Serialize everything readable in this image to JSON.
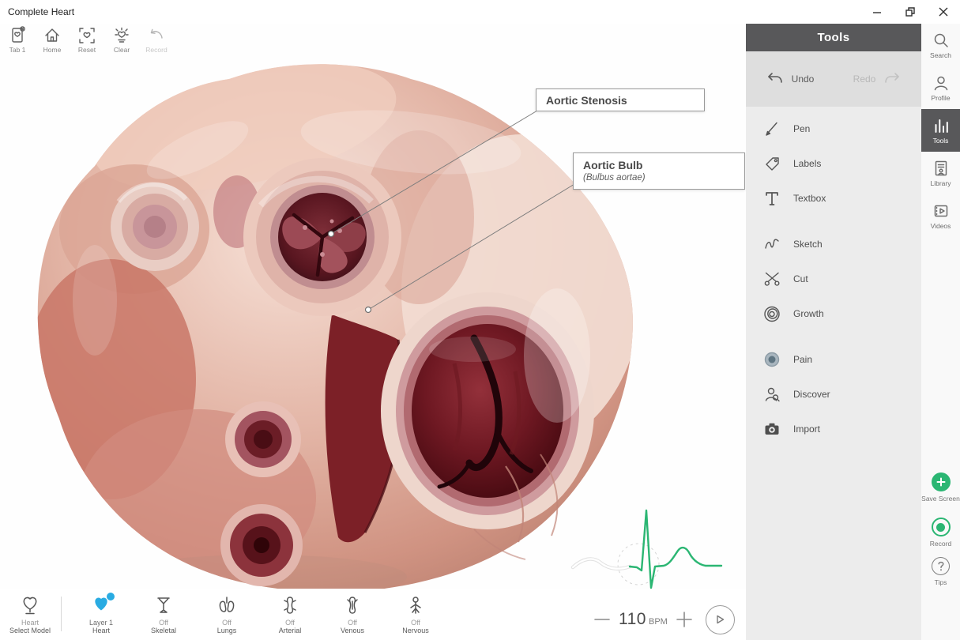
{
  "window": {
    "title": "Complete Heart"
  },
  "toolbar": {
    "items": [
      {
        "label": "Tab 1"
      },
      {
        "label": "Home"
      },
      {
        "label": "Reset"
      },
      {
        "label": "Clear"
      },
      {
        "label": "Record",
        "disabled": true
      }
    ]
  },
  "annotations": [
    {
      "label": "Aortic Stenosis"
    },
    {
      "label": "Aortic Bulb",
      "sublabel": "(Bulbus aortae)"
    }
  ],
  "tools_panel": {
    "title": "Tools",
    "undo_label": "Undo",
    "redo_label": "Redo",
    "tools": [
      {
        "label": "Pen"
      },
      {
        "label": "Labels"
      },
      {
        "label": "Textbox"
      },
      {
        "label": "Sketch"
      },
      {
        "label": "Cut"
      },
      {
        "label": "Growth"
      },
      {
        "label": "Pain"
      },
      {
        "label": "Discover"
      },
      {
        "label": "Import"
      }
    ]
  },
  "rail": {
    "items": [
      {
        "label": "Search"
      },
      {
        "label": "Profile"
      },
      {
        "label": "Tools",
        "active": true
      },
      {
        "label": "Library"
      },
      {
        "label": "Videos"
      }
    ],
    "bottom": [
      {
        "label": "Save Screen"
      },
      {
        "label": "Record"
      },
      {
        "label": "Tips"
      }
    ]
  },
  "bottom_bar": {
    "layers": [
      {
        "state": "Heart",
        "label": "Select Model"
      },
      {
        "state": "Layer 1",
        "label": "Heart",
        "active": true,
        "has_badge": true
      },
      {
        "state": "Off",
        "label": "Skeletal"
      },
      {
        "state": "Off",
        "label": "Lungs"
      },
      {
        "state": "Off",
        "label": "Arterial"
      },
      {
        "state": "Off",
        "label": "Venous"
      },
      {
        "state": "Off",
        "label": "Nervous"
      }
    ],
    "bpm": {
      "value": "110",
      "unit": "BPM"
    }
  },
  "colors": {
    "accent_green": "#2bb673",
    "accent_blue": "#29abe2",
    "header_gray": "#58585a"
  }
}
